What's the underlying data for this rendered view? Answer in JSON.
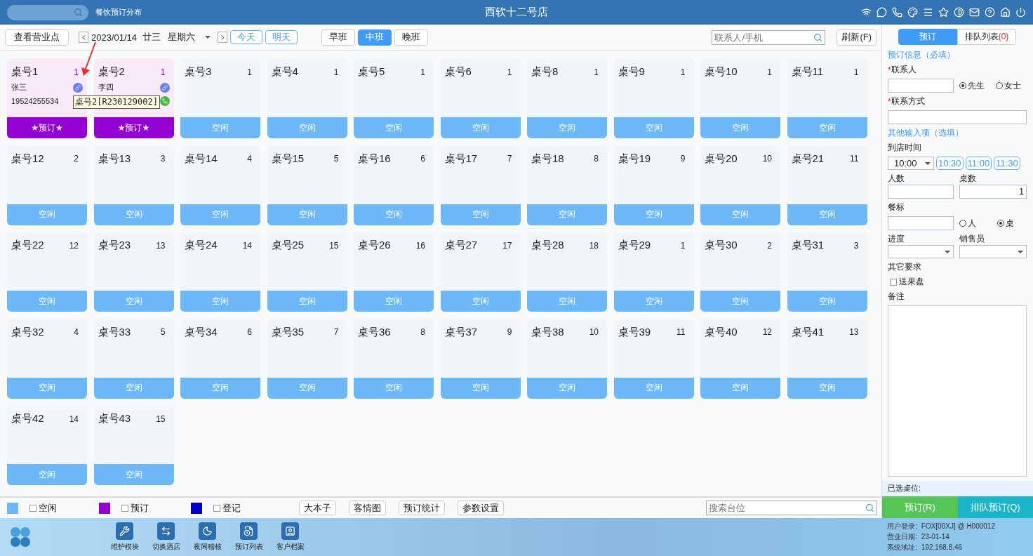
{
  "header": {
    "module": "餐饮预订分布",
    "title": "西软十二号店"
  },
  "toolbar": {
    "view_button": "查看营业点",
    "date": "2023/01/14",
    "lunar": "廿三",
    "weekday": "星期六",
    "day_buttons": [
      "今天",
      "明天"
    ],
    "shifts": [
      {
        "label": "早班",
        "selected": false
      },
      {
        "label": "中班",
        "selected": true
      },
      {
        "label": "晚班",
        "selected": false
      }
    ],
    "contact_search": {
      "placeholder": "联系人/手机"
    },
    "refresh": "刷新(F)"
  },
  "tables": [
    {
      "name": "桌号1",
      "count": "1",
      "kind": "reserved",
      "status": "★预订★",
      "guest": "张三",
      "phone": "19524255534"
    },
    {
      "name": "桌号2",
      "count": "1",
      "kind": "reserved",
      "status": "★预订★",
      "guest": "李四"
    },
    {
      "name": "桌号3",
      "count": "1",
      "kind": "free",
      "status": "空闲"
    },
    {
      "name": "桌号4",
      "count": "1",
      "kind": "free",
      "status": "空闲"
    },
    {
      "name": "桌号5",
      "count": "1",
      "kind": "free",
      "status": "空闲"
    },
    {
      "name": "桌号6",
      "count": "1",
      "kind": "free",
      "status": "空闲"
    },
    {
      "name": "桌号8",
      "count": "1",
      "kind": "free",
      "status": "空闲"
    },
    {
      "name": "桌号9",
      "count": "1",
      "kind": "free",
      "status": "空闲"
    },
    {
      "name": "桌号10",
      "count": "1",
      "kind": "free",
      "status": "空闲"
    },
    {
      "name": "桌号11",
      "count": "1",
      "kind": "free",
      "status": "空闲"
    },
    {
      "name": "桌号12",
      "count": "2",
      "kind": "free",
      "status": "空闲"
    },
    {
      "name": "桌号13",
      "count": "3",
      "kind": "free",
      "status": "空闲"
    },
    {
      "name": "桌号14",
      "count": "4",
      "kind": "free",
      "status": "空闲"
    },
    {
      "name": "桌号15",
      "count": "5",
      "kind": "free",
      "status": "空闲"
    },
    {
      "name": "桌号16",
      "count": "6",
      "kind": "free",
      "status": "空闲"
    },
    {
      "name": "桌号17",
      "count": "7",
      "kind": "free",
      "status": "空闲"
    },
    {
      "name": "桌号18",
      "count": "8",
      "kind": "free",
      "status": "空闲"
    },
    {
      "name": "桌号19",
      "count": "9",
      "kind": "free",
      "status": "空闲"
    },
    {
      "name": "桌号20",
      "count": "10",
      "kind": "free",
      "status": "空闲"
    },
    {
      "name": "桌号21",
      "count": "11",
      "kind": "free",
      "status": "空闲"
    },
    {
      "name": "桌号22",
      "count": "12",
      "kind": "free",
      "status": "空闲"
    },
    {
      "name": "桌号23",
      "count": "13",
      "kind": "free",
      "status": "空闲"
    },
    {
      "name": "桌号24",
      "count": "14",
      "kind": "free",
      "status": "空闲"
    },
    {
      "name": "桌号25",
      "count": "15",
      "kind": "free",
      "status": "空闲"
    },
    {
      "name": "桌号26",
      "count": "16",
      "kind": "free",
      "status": "空闲"
    },
    {
      "name": "桌号27",
      "count": "17",
      "kind": "free",
      "status": "空闲"
    },
    {
      "name": "桌号28",
      "count": "18",
      "kind": "free",
      "status": "空闲"
    },
    {
      "name": "桌号29",
      "count": "1",
      "kind": "free",
      "status": "空闲"
    },
    {
      "name": "桌号30",
      "count": "2",
      "kind": "free",
      "status": "空闲"
    },
    {
      "name": "桌号31",
      "count": "3",
      "kind": "free",
      "status": "空闲"
    },
    {
      "name": "桌号32",
      "count": "4",
      "kind": "free",
      "status": "空闲"
    },
    {
      "name": "桌号33",
      "count": "5",
      "kind": "free",
      "status": "空闲"
    },
    {
      "name": "桌号34",
      "count": "6",
      "kind": "free",
      "status": "空闲"
    },
    {
      "name": "桌号35",
      "count": "7",
      "kind": "free",
      "status": "空闲"
    },
    {
      "name": "桌号36",
      "count": "8",
      "kind": "free",
      "status": "空闲"
    },
    {
      "name": "桌号37",
      "count": "9",
      "kind": "free",
      "status": "空闲"
    },
    {
      "name": "桌号38",
      "count": "10",
      "kind": "free",
      "status": "空闲"
    },
    {
      "name": "桌号39",
      "count": "11",
      "kind": "free",
      "status": "空闲"
    },
    {
      "name": "桌号40",
      "count": "12",
      "kind": "free",
      "status": "空闲"
    },
    {
      "name": "桌号41",
      "count": "13",
      "kind": "free",
      "status": "空闲"
    },
    {
      "name": "桌号42",
      "count": "14",
      "kind": "free",
      "status": "空闲"
    },
    {
      "name": "桌号43",
      "count": "15",
      "kind": "free",
      "status": "空闲"
    }
  ],
  "tooltip": "桌号2[R230129002]",
  "legend": [
    {
      "label": "空闲",
      "color": "#6cb8f8",
      "checked": false
    },
    {
      "label": "预订",
      "color": "#9400d3",
      "checked": false
    },
    {
      "label": "登记",
      "color": "#0000cd",
      "checked": false
    }
  ],
  "bottom_buttons": [
    "大本子",
    "客情图",
    "预订统计",
    "参数设置"
  ],
  "seat_search": {
    "placeholder": "搜索台位"
  },
  "panel": {
    "tabs": [
      {
        "label": "预订",
        "selected": true
      },
      {
        "label": "排队列表",
        "count": "(0)",
        "selected": false
      }
    ],
    "required_mark": "*",
    "required_title": "预订信息（必填）",
    "contact_label": "联系人",
    "titles": [
      {
        "label": "先生",
        "selected": true
      },
      {
        "label": "女士",
        "selected": false
      }
    ],
    "contact_method_label": "联系方式",
    "optional_title": "其他输入项（选填）",
    "arrival_label": "到店时间",
    "arrival_value": "10:00",
    "quick_times": [
      "10:30",
      "11:00",
      "11:30"
    ],
    "people_label": "人数",
    "tables_label": "桌数",
    "tables_value": "1",
    "tag_label": "餐标",
    "tag_units": [
      {
        "label": "人",
        "selected": false
      },
      {
        "label": "桌",
        "selected": true
      }
    ],
    "progress_label": "进度",
    "sales_label": "销售员",
    "other_label": "其它要求",
    "fruit": {
      "label": "送果盘",
      "checked": false
    },
    "notes_label": "备注",
    "selected_label": "已选桌位:",
    "book_button": "预订(R)",
    "queue_button": "排队预订(Q)"
  },
  "dock": [
    {
      "label": "维护模块",
      "kind": "wrench"
    },
    {
      "label": "切换酒店",
      "kind": "swap"
    },
    {
      "label": "夜间稽核",
      "kind": "moon"
    },
    {
      "label": "预订列表",
      "kind": "list"
    },
    {
      "label": "客户档案",
      "kind": "contact"
    }
  ],
  "status": [
    "用户登录:  FOX[00XJ] @ H000012",
    "营业日期:  23-01-14",
    "系统地址:  192.168.8.46"
  ]
}
